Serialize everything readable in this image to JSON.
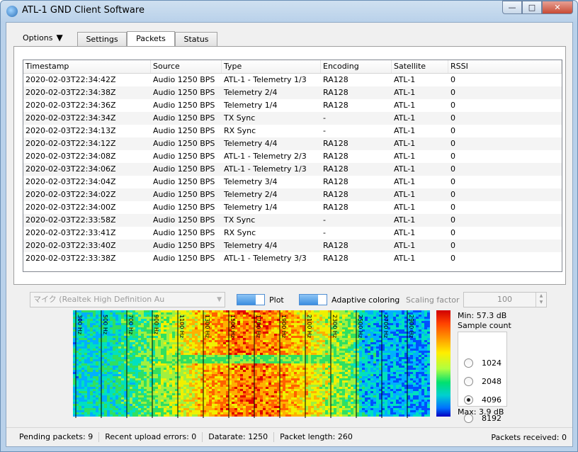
{
  "window": {
    "title": "ATL-1 GND Client Software",
    "minimize": "—",
    "maximize": "□",
    "close": "✕"
  },
  "menu": {
    "options_label": "Options",
    "options_arrow": "▼"
  },
  "tabs": [
    {
      "label": "Settings"
    },
    {
      "label": "Packets"
    },
    {
      "label": "Status"
    }
  ],
  "table": {
    "columns": [
      "Timestamp",
      "Source",
      "Type",
      "Encoding",
      "Satellite",
      "RSSI"
    ],
    "rows": [
      [
        "2020-02-03T22:34:42Z",
        "Audio 1250 BPS",
        "ATL-1 - Telemetry 1/3",
        "RA128",
        "ATL-1",
        "0"
      ],
      [
        "2020-02-03T22:34:38Z",
        "Audio 1250 BPS",
        "Telemetry 2/4",
        "RA128",
        "ATL-1",
        "0"
      ],
      [
        "2020-02-03T22:34:36Z",
        "Audio 1250 BPS",
        "Telemetry 1/4",
        "RA128",
        "ATL-1",
        "0"
      ],
      [
        "2020-02-03T22:34:34Z",
        "Audio 1250 BPS",
        "TX Sync",
        "-",
        "ATL-1",
        "0"
      ],
      [
        "2020-02-03T22:34:13Z",
        "Audio 1250 BPS",
        "RX Sync",
        "-",
        "ATL-1",
        "0"
      ],
      [
        "2020-02-03T22:34:12Z",
        "Audio 1250 BPS",
        "Telemetry 4/4",
        "RA128",
        "ATL-1",
        "0"
      ],
      [
        "2020-02-03T22:34:08Z",
        "Audio 1250 BPS",
        "ATL-1 - Telemetry 2/3",
        "RA128",
        "ATL-1",
        "0"
      ],
      [
        "2020-02-03T22:34:06Z",
        "Audio 1250 BPS",
        "ATL-1 - Telemetry 1/3",
        "RA128",
        "ATL-1",
        "0"
      ],
      [
        "2020-02-03T22:34:04Z",
        "Audio 1250 BPS",
        "Telemetry 3/4",
        "RA128",
        "ATL-1",
        "0"
      ],
      [
        "2020-02-03T22:34:02Z",
        "Audio 1250 BPS",
        "Telemetry 2/4",
        "RA128",
        "ATL-1",
        "0"
      ],
      [
        "2020-02-03T22:34:00Z",
        "Audio 1250 BPS",
        "Telemetry 1/4",
        "RA128",
        "ATL-1",
        "0"
      ],
      [
        "2020-02-03T22:33:58Z",
        "Audio 1250 BPS",
        "TX Sync",
        "-",
        "ATL-1",
        "0"
      ],
      [
        "2020-02-03T22:33:41Z",
        "Audio 1250 BPS",
        "RX Sync",
        "-",
        "ATL-1",
        "0"
      ],
      [
        "2020-02-03T22:33:40Z",
        "Audio 1250 BPS",
        "Telemetry 4/4",
        "RA128",
        "ATL-1",
        "0"
      ],
      [
        "2020-02-03T22:33:38Z",
        "Audio 1250 BPS",
        "ATL-1 - Telemetry 3/3",
        "RA128",
        "ATL-1",
        "0"
      ]
    ]
  },
  "controls": {
    "audio_device": "マイク (Realtek High Definition Au",
    "plot_label": "Plot",
    "adaptive_label": "Adaptive coloring",
    "scaling_label": "Scaling factor",
    "scaling_value": "100"
  },
  "spectrogram": {
    "freq_markers": [
      "300 Hz",
      "500 Hz",
      "700 Hz",
      "900 Hz",
      "1100 Hz",
      "1300 Hz",
      "1500 Hz",
      "1700 Hz",
      "1900 Hz",
      "2100 Hz",
      "2300 Hz",
      "2500 Hz",
      "2700 Hz",
      "2900 Hz"
    ],
    "min_label": "Min: 57.3 dB",
    "max_label": "Max: 3.9 dB",
    "sample_count_label": "Sample count",
    "sample_options": [
      "1024",
      "2048",
      "4096",
      "8192"
    ],
    "selected_sample": "4096"
  },
  "status": {
    "pending": "Pending packets: 9",
    "upload_errors": "Recent upload errors: 0",
    "datarate": "Datarate: 1250",
    "packet_length": "Packet length: 260",
    "received": "Packets received: 0"
  },
  "colors": {
    "accent": "#3b8ee0",
    "titlebar": "#b9d1ea",
    "close": "#c74a35"
  }
}
